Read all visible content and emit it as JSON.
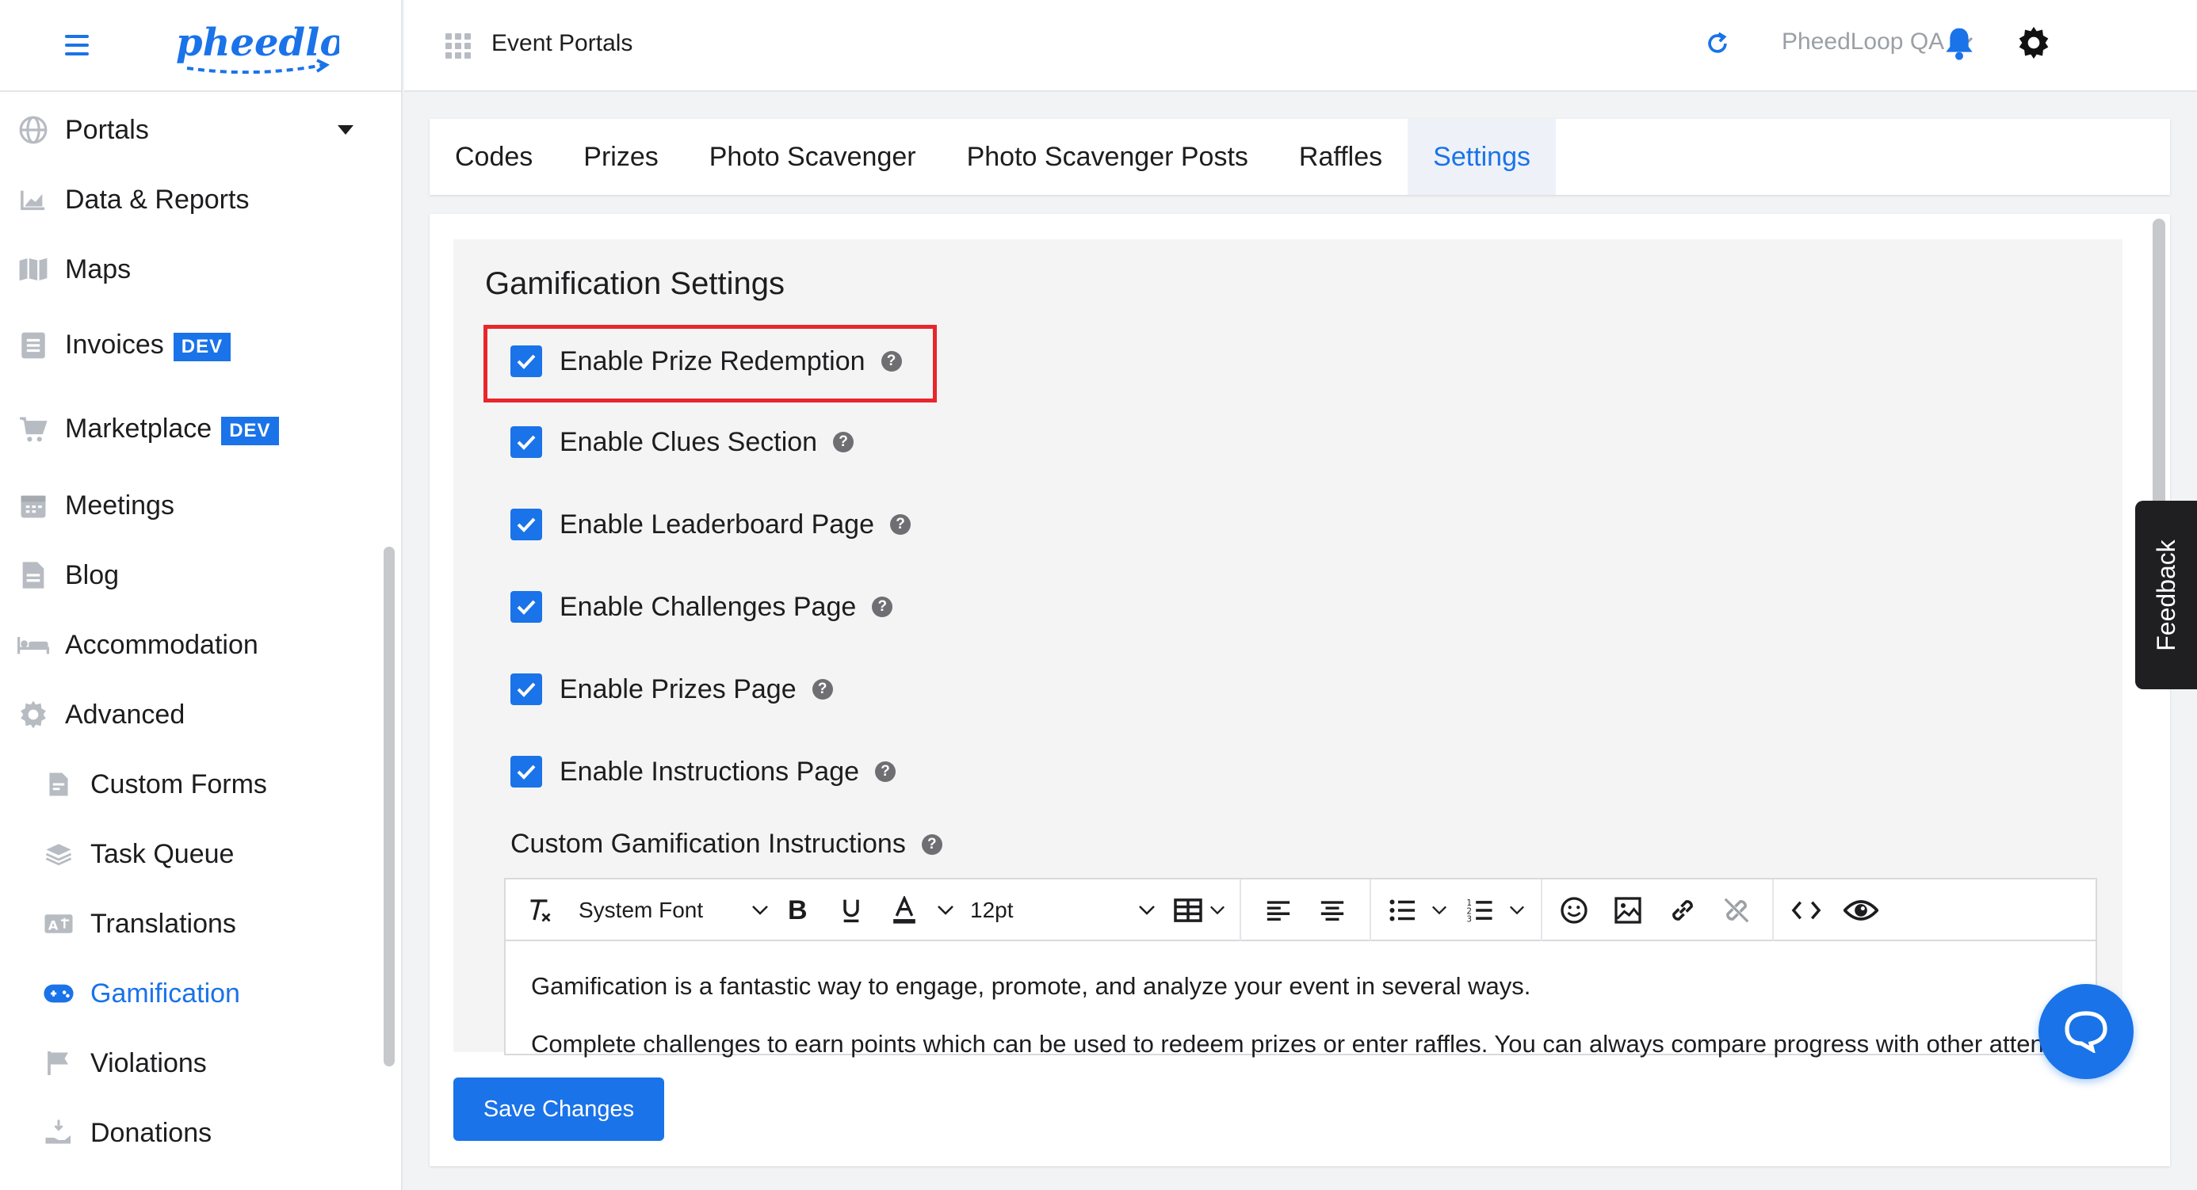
{
  "brand": {
    "logo_text": "pheedloop"
  },
  "topbar": {
    "title": "Event Portals",
    "org": "PheedLoop QA"
  },
  "sidebar": {
    "items": [
      {
        "label": "Portals",
        "icon": "globe-icon"
      },
      {
        "label": "Data & Reports",
        "icon": "chart-icon"
      },
      {
        "label": "Maps",
        "icon": "map-icon"
      },
      {
        "label": "Invoices",
        "icon": "invoice-icon",
        "badge": "DEV"
      },
      {
        "label": "Marketplace",
        "icon": "cart-icon",
        "badge": "DEV"
      },
      {
        "label": "Meetings",
        "icon": "calendar-icon"
      },
      {
        "label": "Blog",
        "icon": "document-icon"
      },
      {
        "label": "Accommodation",
        "icon": "bed-icon"
      },
      {
        "label": "Advanced",
        "icon": "gear-icon"
      },
      {
        "label": "Custom Forms",
        "icon": "form-icon"
      },
      {
        "label": "Task Queue",
        "icon": "layers-icon"
      },
      {
        "label": "Translations",
        "icon": "translate-icon"
      },
      {
        "label": "Gamification",
        "icon": "gamepad-icon"
      },
      {
        "label": "Violations",
        "icon": "flag-icon"
      },
      {
        "label": "Donations",
        "icon": "donation-icon"
      }
    ]
  },
  "tabs": [
    "Codes",
    "Prizes",
    "Photo Scavenger",
    "Photo Scavenger Posts",
    "Raffles",
    "Settings"
  ],
  "active_tab": "Settings",
  "settings": {
    "title": "Gamification Settings",
    "options": [
      {
        "label": "Enable Prize Redemption",
        "checked": true
      },
      {
        "label": "Enable Clues Section",
        "checked": true
      },
      {
        "label": "Enable Leaderboard Page",
        "checked": true
      },
      {
        "label": "Enable Challenges Page",
        "checked": true
      },
      {
        "label": "Enable Prizes Page",
        "checked": true
      },
      {
        "label": "Enable Instructions Page",
        "checked": true
      }
    ],
    "instructions_label": "Custom Gamification Instructions",
    "help_glyph": "?"
  },
  "editor": {
    "font": "System Font",
    "size": "12pt",
    "paragraph_1": "Gamification is a fantastic way to engage, promote, and analyze your event in several ways.",
    "paragraph_2": "Complete challenges to earn points which can be used to redeem prizes or enter raffles. You can always compare progress with other attendees."
  },
  "buttons": {
    "save": "Save Changes"
  },
  "feedback_label": "Feedback",
  "colors": {
    "accent": "#1a73e8",
    "highlight": "#e8262b"
  }
}
